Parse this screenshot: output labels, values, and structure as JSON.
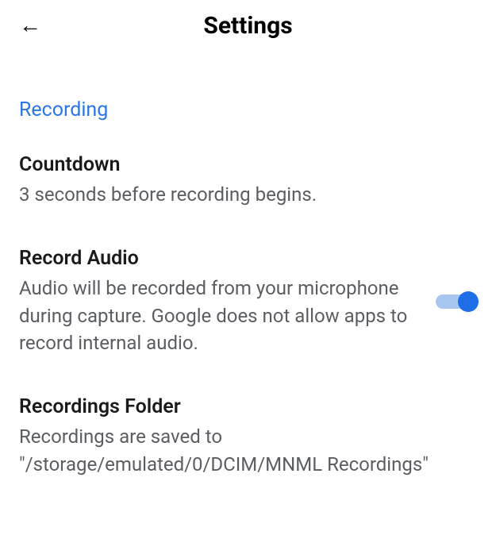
{
  "header": {
    "title": "Settings"
  },
  "section": {
    "label": "Recording"
  },
  "settings": {
    "countdown": {
      "title": "Countdown",
      "description": "3 seconds before recording begins."
    },
    "recordAudio": {
      "title": "Record Audio",
      "description": "Audio will be recorded from your microphone during capture. Google does not allow apps to record internal audio.",
      "enabled": true
    },
    "recordingsFolder": {
      "title": "Recordings Folder",
      "description": "Recordings are saved to \"/storage/emulated/0/DCIM/MNML Recordings\""
    }
  }
}
